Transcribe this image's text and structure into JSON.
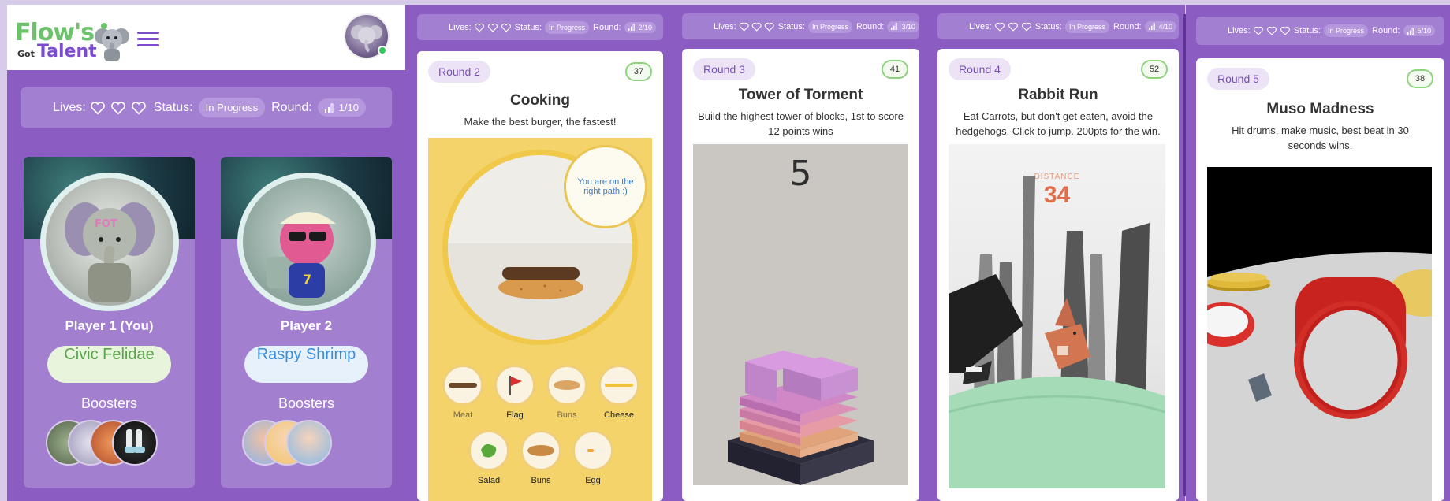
{
  "colors": {
    "brand_green": "#6cc26a",
    "brand_purple": "#7c4bd0",
    "panel_bg": "#8b5cc2",
    "online": "#34c759"
  },
  "header": {
    "logo_line1": "Flow's",
    "logo_got": "Got",
    "logo_line2": "Talent",
    "menu_icon": "hamburger-icon",
    "avatar_icon": "user-avatar"
  },
  "status_main": {
    "lives_label": "Lives:",
    "lives_icon": "heart-outline-icon",
    "status_label": "Status:",
    "status_value": "In Progress",
    "round_label": "Round:",
    "round_value": "1/10",
    "round_icon": "signal-bars-icon"
  },
  "players": [
    {
      "label": "Player 1 (You)",
      "nickname": "Civic Felidae",
      "boosters_label": "Boosters",
      "nick_bg": "#e8f4dc",
      "nick_color": "#5aa34a"
    },
    {
      "label": "Player 2",
      "nickname": "Raspy Shrimp",
      "boosters_label": "Boosters",
      "nick_bg": "#e6f1fb",
      "nick_color": "#3a8ed8"
    }
  ],
  "games": [
    {
      "status": {
        "lives_label": "Lives:",
        "status_label": "Status:",
        "status_value": "In Progress",
        "round_label": "Round:",
        "round_value": "2/10"
      },
      "round": "Round 2",
      "score": "37",
      "title": "Cooking",
      "desc": "Make the best burger, the fastest!",
      "hint": "You are on the right path :)",
      "ingredients": [
        "Meat",
        "Flag",
        "Buns",
        "Cheese",
        "Salad",
        "Buns",
        "Egg"
      ]
    },
    {
      "status": {
        "lives_label": "Lives:",
        "status_label": "Status:",
        "status_value": "In Progress",
        "round_label": "Round:",
        "round_value": "3/10"
      },
      "round": "Round 3",
      "score": "41",
      "title": "Tower of Torment",
      "desc": "Build the highest tower of blocks, 1st to score 12 points wins",
      "game_score": "5"
    },
    {
      "status": {
        "lives_label": "Lives:",
        "status_label": "Status:",
        "status_value": "In Progress",
        "round_label": "Round:",
        "round_value": "4/10"
      },
      "round": "Round 4",
      "score": "52",
      "title": "Rabbit Run",
      "desc": "Eat Carrots, but don't get eaten, avoid the hedgehogs. Click to jump. 200pts for the win.",
      "distance_label": "DISTANCE",
      "distance_value": "34"
    },
    {
      "status": {
        "lives_label": "Lives:",
        "status_label": "Status:",
        "status_value": "In Progress",
        "round_label": "Round:",
        "round_value": "5/10"
      },
      "round": "Round 5",
      "score": "38",
      "title": "Muso Madness",
      "desc": "Hit drums, make music, best beat in 30 seconds wins."
    }
  ]
}
